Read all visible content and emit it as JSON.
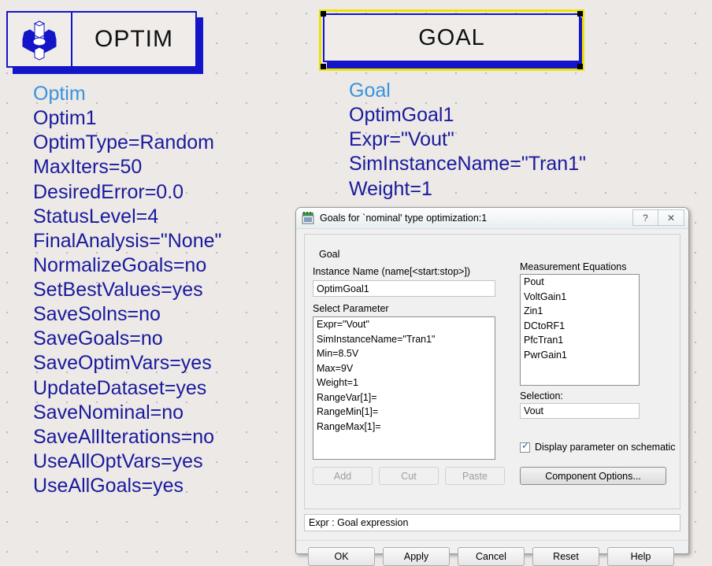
{
  "canvas": {
    "background": "#ece9e7",
    "grid_spacing_px": 38
  },
  "schematic": {
    "optim_symbol": {
      "icon": "gear-3d-icon",
      "label": "OPTIM",
      "border_color": "#1414c8",
      "shadow_color": "#1414c8"
    },
    "goal_symbol": {
      "label": "GOAL",
      "selected": true,
      "selection_color": "#ece400",
      "border_color": "#1414c8"
    },
    "optim_params": {
      "component_type": "Optim",
      "lines": [
        "Optim1",
        "OptimType=Random",
        "MaxIters=50",
        "DesiredError=0.0",
        "StatusLevel=4",
        "FinalAnalysis=\"None\"",
        "NormalizeGoals=no",
        "SetBestValues=yes",
        "SaveSolns=no",
        "SaveGoals=no",
        "SaveOptimVars=yes",
        "UpdateDataset=yes",
        "SaveNominal=no",
        "SaveAllIterations=no",
        "UseAllOptVars=yes",
        "UseAllGoals=yes"
      ],
      "type_color": "#3a93dd",
      "text_color": "#1a1a9c"
    },
    "goal_params": {
      "component_type": "Goal",
      "lines": [
        "OptimGoal1",
        "Expr=\"Vout\"",
        "SimInstanceName=\"Tran1\"",
        "Weight=1"
      ]
    }
  },
  "dialog": {
    "title": "Goals for `nominal' type optimization:1",
    "title_icon": "form-window-icon",
    "help_button": "?",
    "close_button": "✕",
    "goal_group_label": "Goal",
    "instance_name_label": "Instance Name  (name[<start:stop>])",
    "instance_name_value": "OptimGoal1",
    "select_parameter_label": "Select Parameter",
    "parameter_list": [
      "Expr=\"Vout\"",
      "SimInstanceName=\"Tran1\"",
      "Min=8.5V",
      "Max=9V",
      "Weight=1",
      "RangeVar[1]=",
      "RangeMin[1]=",
      "RangeMax[1]="
    ],
    "parameter_selected_index": 0,
    "measurement_equations_label": "Measurement Equations",
    "measurement_equations": [
      "Pout",
      "VoltGain1",
      "Zin1",
      "DCtoRF1",
      "PfcTran1",
      "PwrGain1"
    ],
    "selection_label": "Selection:",
    "selection_value": "Vout",
    "display_param_checkbox": {
      "label": "Display parameter on schematic",
      "checked": true
    },
    "component_options_button": "Component Options...",
    "edit_buttons": [
      {
        "label": "Add",
        "enabled": false
      },
      {
        "label": "Cut",
        "enabled": false
      },
      {
        "label": "Paste",
        "enabled": false
      }
    ],
    "status_text": "Expr : Goal expression",
    "action_buttons": [
      "OK",
      "Apply",
      "Cancel",
      "Reset",
      "Help"
    ]
  }
}
